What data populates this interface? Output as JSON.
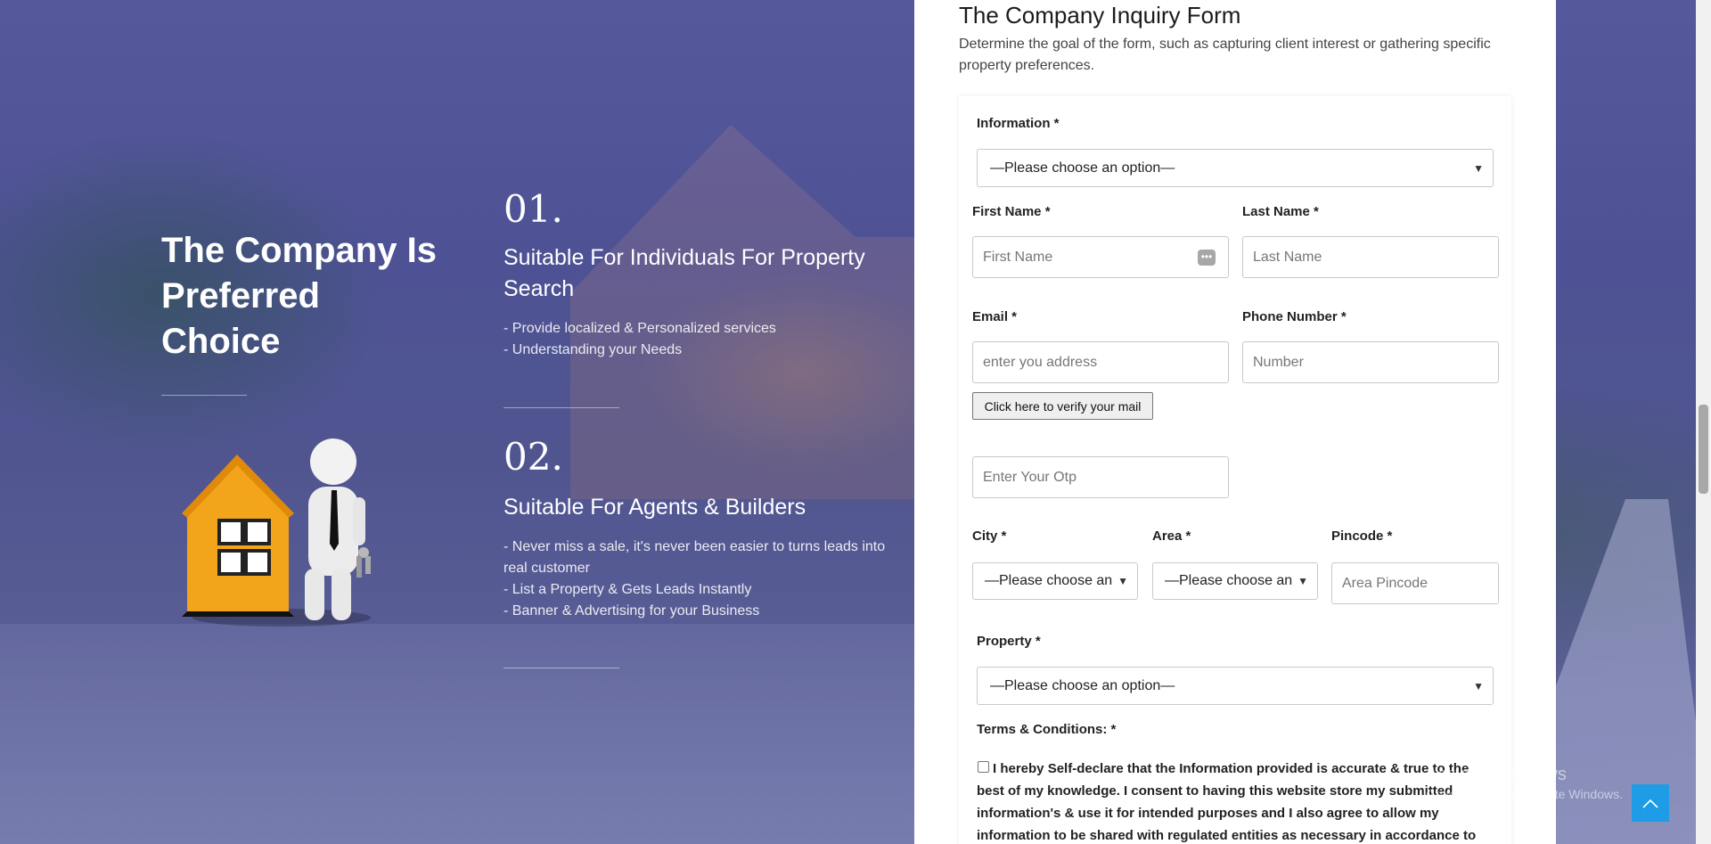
{
  "hero": {
    "headline": "The Company Is Preferred Choice",
    "steps": [
      {
        "number": "01.",
        "title": "Suitable For Individuals For Property Search",
        "lines": [
          "- Provide localized & Personalized services",
          "- Understanding your Needs"
        ]
      },
      {
        "number": "02.",
        "title": "Suitable For Agents & Builders",
        "lines": [
          "- Never miss a sale, it's never been easier to turns leads into",
          "real customer",
          "- List a Property & Gets Leads Instantly",
          "- Banner & Advertising for your Business"
        ]
      }
    ]
  },
  "form": {
    "title": "The Company Inquiry Form",
    "description": "Determine the goal of the form, such as capturing client interest or gathering specific property preferences.",
    "information": {
      "label": "Information *",
      "value": "—Please choose an option—"
    },
    "first_name": {
      "label": "First Name *",
      "placeholder": "First Name"
    },
    "last_name": {
      "label": "Last Name *",
      "placeholder": "Last Name"
    },
    "email": {
      "label": "Email *",
      "placeholder": "enter you address"
    },
    "phone": {
      "label": "Phone Number *",
      "placeholder": "Number"
    },
    "verify_button": "Click here to verify your mail",
    "otp": {
      "placeholder": "Enter Your Otp"
    },
    "city": {
      "label": "City *",
      "value": "—Please choose an"
    },
    "area": {
      "label": "Area *",
      "value": "—Please choose an"
    },
    "pincode": {
      "label": "Pincode *",
      "placeholder": "Area Pincode"
    },
    "property": {
      "label": "Property *",
      "value": "—Please choose an option—"
    },
    "terms": {
      "label": "Terms & Conditions: *",
      "text": "I hereby Self-declare that the Information provided is accurate & true to the best of my knowledge. I consent to having this website store my submitted information's & use it for intended purposes and I also agree to allow my information to be shared with regulated entities as necessary in accordance to applicable laws and regulations."
    }
  },
  "watermark": {
    "line1": "Activate Windows",
    "line2": "Go to Settings to activate Windows."
  },
  "colors": {
    "accent": "#1e9ce6",
    "overlay": "#4e5294"
  },
  "icons": {
    "scroll_top": "chevron-up-icon",
    "password_manager": "key-menu-icon"
  }
}
